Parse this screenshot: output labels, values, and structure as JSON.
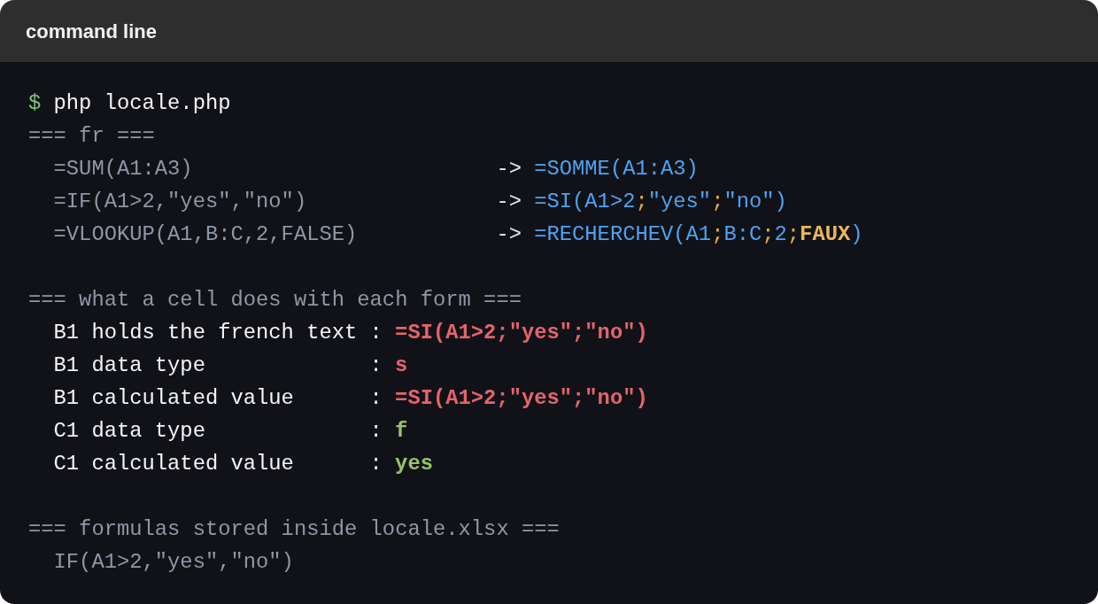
{
  "header": {
    "title": "command line"
  },
  "lines": [
    {
      "kind": "prompt",
      "prompt": "$",
      "command": "php locale.php"
    },
    {
      "kind": "heading",
      "text": "=== fr ==="
    },
    {
      "kind": "mapping",
      "source": "=SUM(A1:A3)",
      "arrow": "->",
      "target": [
        {
          "kind": "formula",
          "text": "=SOMME(A1:A3)"
        }
      ]
    },
    {
      "kind": "mapping",
      "source": "=IF(A1>2,\"yes\",\"no\")",
      "arrow": "->",
      "target": [
        {
          "kind": "formula",
          "text": "=SI(A1>2"
        },
        {
          "kind": "separator",
          "text": ";"
        },
        {
          "kind": "formula",
          "text": "\"yes\""
        },
        {
          "kind": "separator",
          "text": ";"
        },
        {
          "kind": "formula",
          "text": "\"no\")"
        }
      ]
    },
    {
      "kind": "mapping",
      "source": "=VLOOKUP(A1,B:C,2,FALSE)",
      "arrow": "->",
      "target": [
        {
          "kind": "formula",
          "text": "=RECHERCHEV(A1"
        },
        {
          "kind": "separator",
          "text": ";"
        },
        {
          "kind": "formula",
          "text": "B:C"
        },
        {
          "kind": "separator",
          "text": ";"
        },
        {
          "kind": "formula",
          "text": "2"
        },
        {
          "kind": "separator",
          "text": ";"
        },
        {
          "kind": "keyword",
          "text": "FAUX"
        },
        {
          "kind": "formula",
          "text": ")"
        }
      ]
    },
    {
      "kind": "blank"
    },
    {
      "kind": "heading",
      "text": "=== what a cell does with each form ==="
    },
    {
      "kind": "field",
      "label": "B1 holds the french text",
      "colon": ":",
      "value": "=SI(A1>2;\"yes\";\"no\")",
      "color": "#e5646c"
    },
    {
      "kind": "field",
      "label": "B1 data type",
      "colon": ":",
      "value": "s",
      "color": "#e5646c"
    },
    {
      "kind": "field",
      "label": "B1 calculated value",
      "colon": ":",
      "value": "=SI(A1>2;\"yes\";\"no\")",
      "color": "#e5646c"
    },
    {
      "kind": "field",
      "label": "C1 data type",
      "colon": ":",
      "value": "f",
      "color": "#98c36f"
    },
    {
      "kind": "field",
      "label": "C1 calculated value",
      "colon": ":",
      "value": "yes",
      "color": "#98c36f"
    },
    {
      "kind": "blank"
    },
    {
      "kind": "heading",
      "text": "=== formulas stored inside locale.xlsx ==="
    },
    {
      "kind": "plain",
      "text": "IF(A1>2,\"yes\",\"no\")"
    }
  ]
}
